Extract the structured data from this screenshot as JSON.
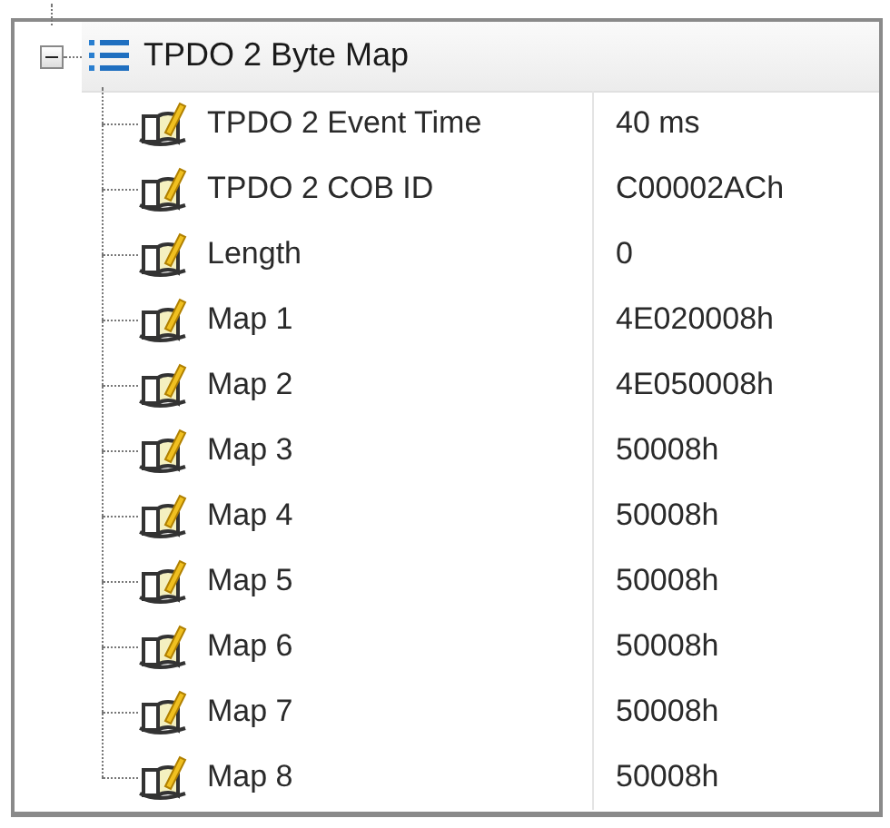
{
  "tree": {
    "label": "TPDO 2 Byte Map",
    "expanded": true,
    "children": [
      {
        "name": "TPDO 2 Event Time",
        "value": "40 ms"
      },
      {
        "name": "TPDO 2 COB ID",
        "value": "C00002ACh"
      },
      {
        "name": "Length",
        "value": "0"
      },
      {
        "name": "Map 1",
        "value": "4E020008h"
      },
      {
        "name": "Map 2",
        "value": "4E050008h"
      },
      {
        "name": "Map 3",
        "value": "50008h"
      },
      {
        "name": "Map 4",
        "value": "50008h"
      },
      {
        "name": "Map 5",
        "value": "50008h"
      },
      {
        "name": "Map 6",
        "value": "50008h"
      },
      {
        "name": "Map 7",
        "value": "50008h"
      },
      {
        "name": "Map 8",
        "value": "50008h"
      }
    ]
  }
}
